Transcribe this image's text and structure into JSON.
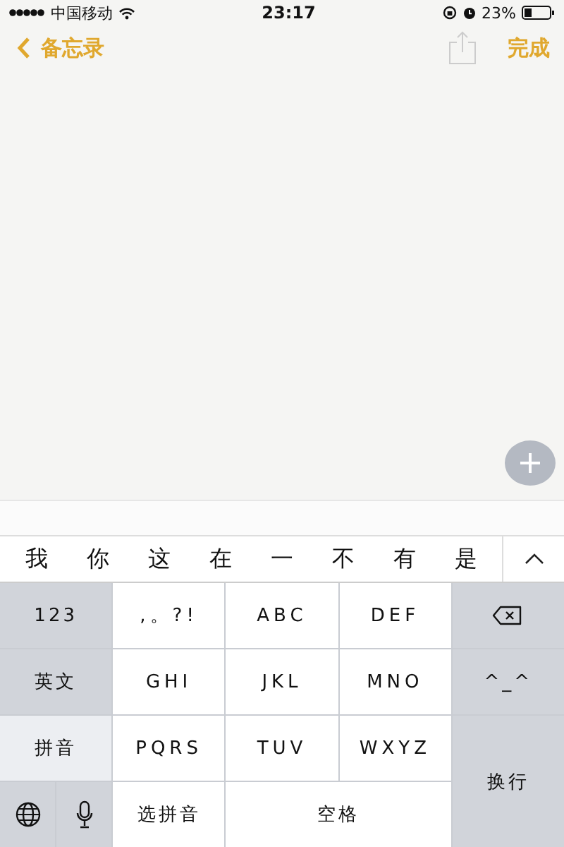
{
  "status_bar": {
    "carrier": "中国移动",
    "time": "23:17",
    "battery": "23%"
  },
  "nav": {
    "back": "备忘录",
    "done": "完成"
  },
  "candidates": [
    "我",
    "你",
    "这",
    "在",
    "一",
    "不",
    "有",
    "是"
  ],
  "keys": [
    {
      "kind": "mode",
      "label": "123",
      "selected": false
    },
    {
      "kind": "letter",
      "label": ",。?!"
    },
    {
      "kind": "letter",
      "label": "ABC"
    },
    {
      "kind": "letter",
      "label": "DEF"
    },
    {
      "kind": "delete"
    },
    {
      "kind": "mode",
      "label": "英文",
      "selected": false
    },
    {
      "kind": "letter",
      "label": "GHI"
    },
    {
      "kind": "letter",
      "label": "JKL"
    },
    {
      "kind": "letter",
      "label": "MNO"
    },
    {
      "kind": "function",
      "label": "^_^"
    },
    {
      "kind": "mode",
      "label": "拼音",
      "selected": true
    },
    {
      "kind": "letter",
      "label": "PQRS"
    },
    {
      "kind": "letter",
      "label": "TUV"
    },
    {
      "kind": "letter",
      "label": "WXYZ"
    },
    {
      "kind": "function",
      "label": "换行"
    },
    {
      "kind": "globe"
    },
    {
      "kind": "mic"
    },
    {
      "kind": "word",
      "label": "选拼音"
    },
    {
      "kind": "word",
      "label": "空格"
    }
  ]
}
